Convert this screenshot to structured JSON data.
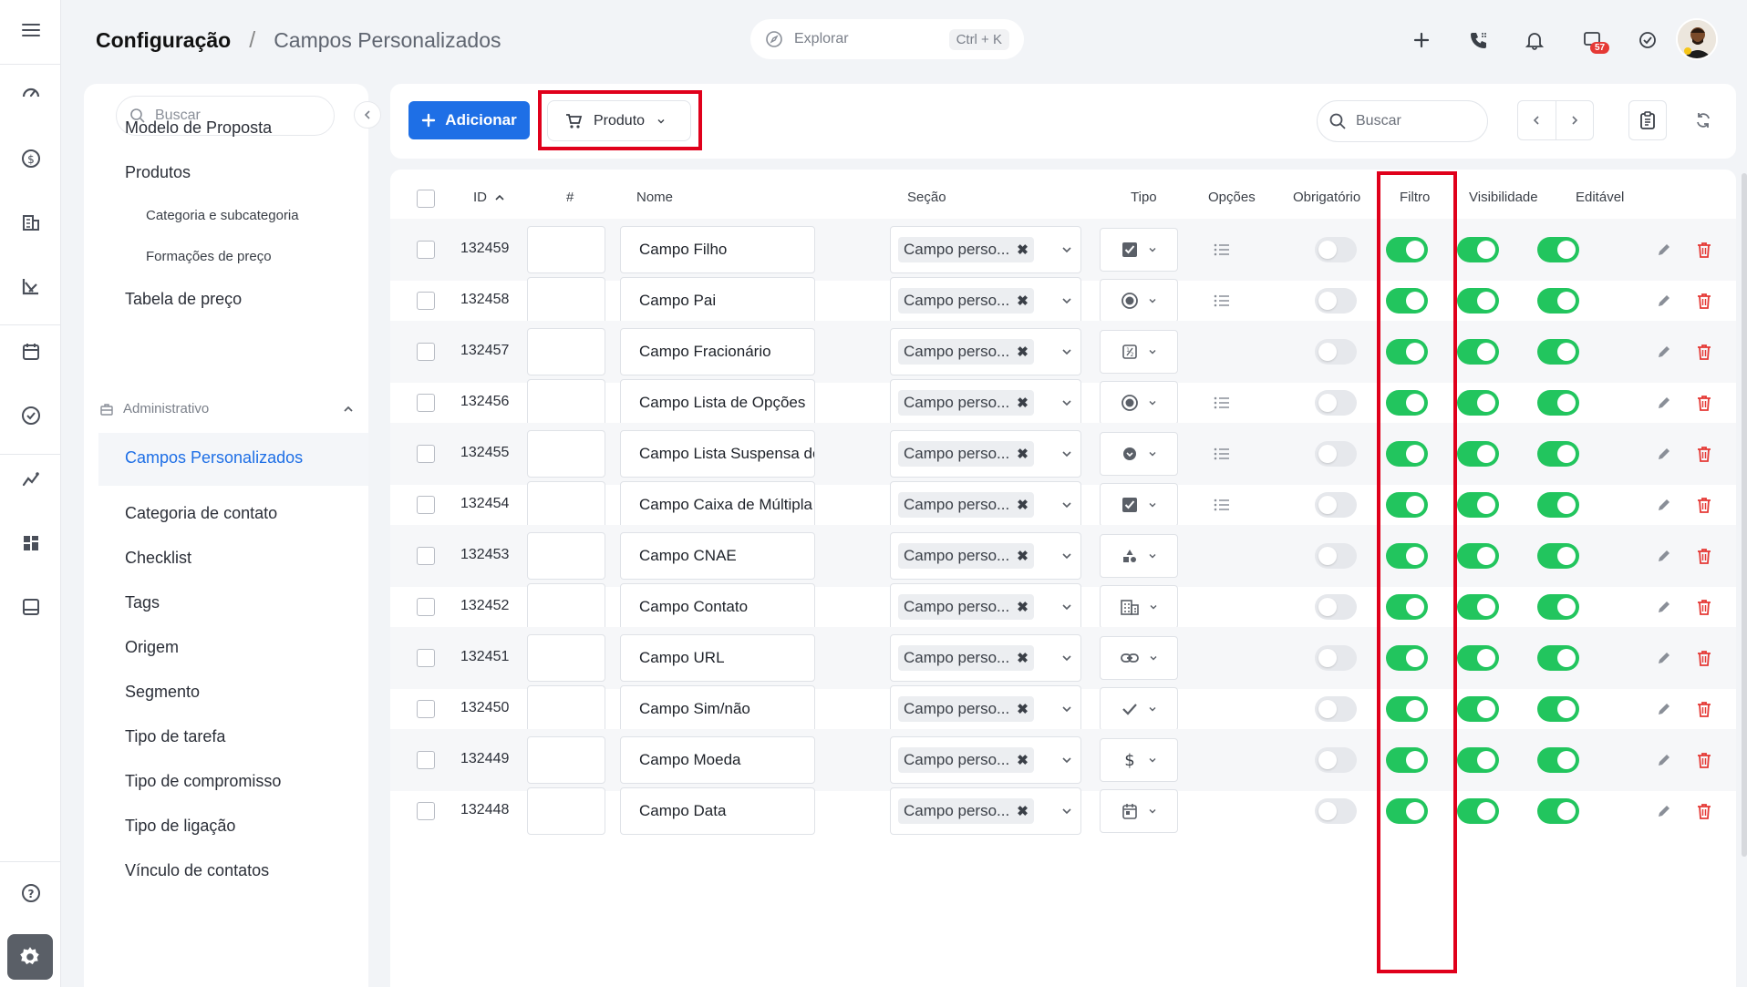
{
  "header": {
    "title": "Configuração",
    "separator": "/",
    "subtitle": "Campos Personalizados",
    "explore_placeholder": "Explorar",
    "explore_shortcut": "Ctrl + K",
    "chat_badge": "57"
  },
  "rail": {
    "icons": [
      "menu-icon",
      "dashboard-icon",
      "money-icon",
      "building-icon",
      "chart-icon",
      "calendar-icon",
      "check-circle-icon",
      "trend-icon",
      "widgets-icon",
      "inbox-icon",
      "help-icon",
      "settings-icon"
    ]
  },
  "sidebar": {
    "search_placeholder": "Buscar",
    "items": [
      {
        "label": "Modelo de Proposta"
      },
      {
        "label": "Produtos"
      },
      {
        "label": "Categoria e subcategoria"
      },
      {
        "label": "Formações de preço"
      },
      {
        "label": "Tabela de preço"
      },
      {
        "label": "Administrativo"
      },
      {
        "label": "Campos Personalizados"
      },
      {
        "label": "Categoria de contato"
      },
      {
        "label": "Checklist"
      },
      {
        "label": "Tags"
      },
      {
        "label": "Origem"
      },
      {
        "label": "Segmento"
      },
      {
        "label": "Tipo de tarefa"
      },
      {
        "label": "Tipo de compromisso"
      },
      {
        "label": "Tipo de ligação"
      },
      {
        "label": "Vínculo de contatos"
      }
    ],
    "active_color": "#1e6fe6"
  },
  "toolbar": {
    "add_label": "Adicionar",
    "product_label": "Produto",
    "search_placeholder": "Buscar"
  },
  "table": {
    "columns": [
      "ID",
      "#",
      "Nome",
      "Seção",
      "Tipo",
      "Opções",
      "Obrigatório",
      "Filtro",
      "Visibilidade",
      "Editável"
    ],
    "rows": [
      {
        "id": "132459",
        "name": "Campo Filho",
        "section": "Campo perso...",
        "type_icon": "checkbox-icon",
        "has_options": true,
        "required": false,
        "filter": true,
        "visible": true,
        "editable": true
      },
      {
        "id": "132458",
        "name": "Campo Pai",
        "section": "Campo perso...",
        "type_icon": "radio-icon",
        "has_options": true,
        "required": false,
        "filter": true,
        "visible": true,
        "editable": true
      },
      {
        "id": "132457",
        "name": "Campo Fracionário",
        "section": "Campo perso...",
        "type_icon": "fraction-icon",
        "has_options": false,
        "required": false,
        "filter": true,
        "visible": true,
        "editable": true
      },
      {
        "id": "132456",
        "name": "Campo Lista de Opções",
        "section": "Campo perso...",
        "type_icon": "radio-icon",
        "has_options": true,
        "required": false,
        "filter": true,
        "visible": true,
        "editable": true
      },
      {
        "id": "132455",
        "name": "Campo Lista Suspensa de (",
        "section": "Campo perso...",
        "type_icon": "dropdown-icon",
        "has_options": true,
        "required": false,
        "filter": true,
        "visible": true,
        "editable": true
      },
      {
        "id": "132454",
        "name": "Campo Caixa de Múltipla E:",
        "section": "Campo perso...",
        "type_icon": "checkbox-icon",
        "has_options": true,
        "required": false,
        "filter": true,
        "visible": true,
        "editable": true
      },
      {
        "id": "132453",
        "name": "Campo CNAE",
        "section": "Campo perso...",
        "type_icon": "shapes-icon",
        "has_options": false,
        "required": false,
        "filter": true,
        "visible": true,
        "editable": true
      },
      {
        "id": "132452",
        "name": "Campo Contato",
        "section": "Campo perso...",
        "type_icon": "building-icon",
        "has_options": false,
        "required": false,
        "filter": true,
        "visible": true,
        "editable": true
      },
      {
        "id": "132451",
        "name": "Campo URL",
        "section": "Campo perso...",
        "type_icon": "link-icon",
        "has_options": false,
        "required": false,
        "filter": true,
        "visible": true,
        "editable": true
      },
      {
        "id": "132450",
        "name": "Campo Sim/não",
        "section": "Campo perso...",
        "type_icon": "check-icon",
        "has_options": false,
        "required": false,
        "filter": true,
        "visible": true,
        "editable": true
      },
      {
        "id": "132449",
        "name": "Campo Moeda",
        "section": "Campo perso...",
        "type_icon": "dollar-icon",
        "has_options": false,
        "required": false,
        "filter": true,
        "visible": true,
        "editable": true
      },
      {
        "id": "132448",
        "name": "Campo Data",
        "section": "Campo perso...",
        "type_icon": "calendar-icon",
        "has_options": false,
        "required": false,
        "filter": true,
        "visible": true,
        "editable": true
      }
    ]
  },
  "colors": {
    "primary": "#1e6fe6",
    "toggle_on": "#22c55e",
    "delete": "#e53935",
    "highlight": "#e0001b"
  }
}
